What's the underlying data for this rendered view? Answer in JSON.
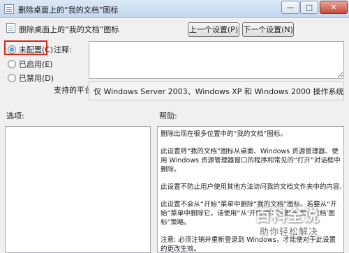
{
  "window": {
    "title": "删除桌面上的“我的文档”图标",
    "minimize_glyph": "—",
    "maximize_glyph": "□",
    "close_glyph": "✕"
  },
  "header": {
    "policy_name": "删除桌面上的“我的文档”图标",
    "prev_button": "上一个设置(P)",
    "next_button": "下一个设置(N)"
  },
  "state": {
    "options": [
      {
        "label": "未配置(C)",
        "checked": true
      },
      {
        "label": "已启用(E)",
        "checked": false
      },
      {
        "label": "已禁用(D)",
        "checked": false
      }
    ],
    "highlight_color": "#e2231a"
  },
  "comment": {
    "label": "注释:",
    "value": ""
  },
  "platform": {
    "label": "支持的平台:",
    "value": "仅 Windows Server 2003、Windows XP 和 Windows 2000 操作系统"
  },
  "options_pane": {
    "label": "选项:"
  },
  "help_pane": {
    "label": "帮助:",
    "paragraphs": [
      "删除出现在很多位置中的“我的文档”图标。",
      "此设置将“我的文档”图标从桌面、Windows 资源管理器、使用 Windows 资源管理器窗口的程序和常见的“打开”对话框中删除。",
      "此设置不防止用户使用其他方法访问我的文档文件夹中的内容。",
      "此设置不会从“开始”菜单中删除“我的文档”图标。若要从“开始”菜单中删除它，请使用“从‘开始’菜单中删除‘我的文档’图标”策略。",
      "注意: 必须注销并重新登录到 Windows，才能使对于此设置的更改生效。"
    ]
  },
  "watermark": {
    "logo": "百科全说",
    "subtitle": "助你轻松解决"
  }
}
